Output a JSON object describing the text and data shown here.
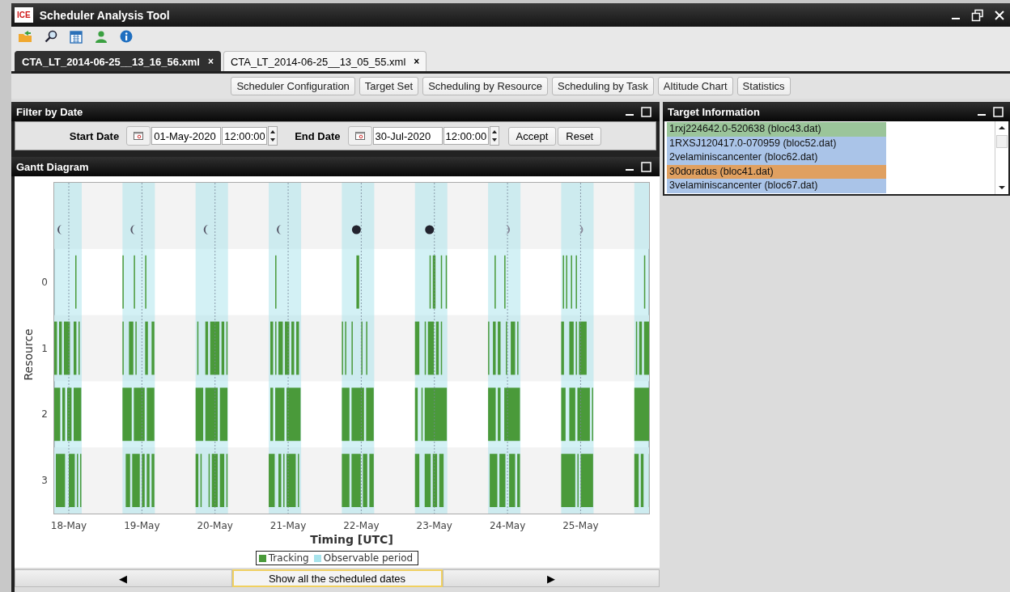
{
  "window": {
    "logo": "ICE",
    "title": "Scheduler Analysis Tool"
  },
  "file_tabs": [
    {
      "label": "CTA_LT_2014-06-25__13_16_56.xml",
      "close": "×",
      "selected": true
    },
    {
      "label": "CTA_LT_2014-06-25__13_05_55.xml",
      "close": "×",
      "selected": false
    }
  ],
  "views": [
    "Scheduler Configuration",
    "Target Set",
    "Scheduling by Resource",
    "Scheduling by Task",
    "Altitude Chart",
    "Statistics"
  ],
  "filter": {
    "title": "Filter by Date",
    "start_label": "Start Date",
    "start_date": "01-May-2020",
    "start_time": "12:00:00",
    "end_label": "End Date",
    "end_date": "30-Jul-2020",
    "end_time": "12:00:00",
    "buttons": [
      "Accept",
      "Reset"
    ]
  },
  "gantt": {
    "title": "Gantt Diagram",
    "ylabel": "Resource",
    "xlabel": "Timing [UTC]",
    "resources": [
      "0",
      "1",
      "2",
      "3"
    ],
    "days": [
      {
        "label": "18-May",
        "kind": "waning"
      },
      {
        "label": "19-May",
        "kind": "waning"
      },
      {
        "label": "20-May",
        "kind": "waning"
      },
      {
        "label": "21-May",
        "kind": "waning"
      },
      {
        "label": "22-May",
        "kind": "new"
      },
      {
        "label": "23-May",
        "kind": "new"
      },
      {
        "label": "24-May",
        "kind": "waxing"
      },
      {
        "label": "25-May",
        "kind": "waxing"
      }
    ],
    "legend": [
      {
        "label": "Tracking",
        "color": "#4a9a3a"
      },
      {
        "label": "Observable period",
        "color": "#a8e4ec"
      }
    ],
    "nav": {
      "prev": "◀",
      "show_all": "Show all the scheduled dates",
      "next": "▶"
    }
  },
  "targets": {
    "title": "Target Information",
    "items": [
      {
        "label": "1rxj224642.0-520638 (bloc43.dat)",
        "color": "#9bc59a"
      },
      {
        "label": "1RXSJ120417.0-070959 (bloc52.dat)",
        "color": "#aac4e8"
      },
      {
        "label": "2velaminiscancenter (bloc62.dat)",
        "color": "#aac4e8"
      },
      {
        "label": "30doradus (bloc41.dat)",
        "color": "#e0a060"
      },
      {
        "label": "3velaminiscancenter (bloc67.dat)",
        "color": "#aac4e8"
      }
    ]
  }
}
